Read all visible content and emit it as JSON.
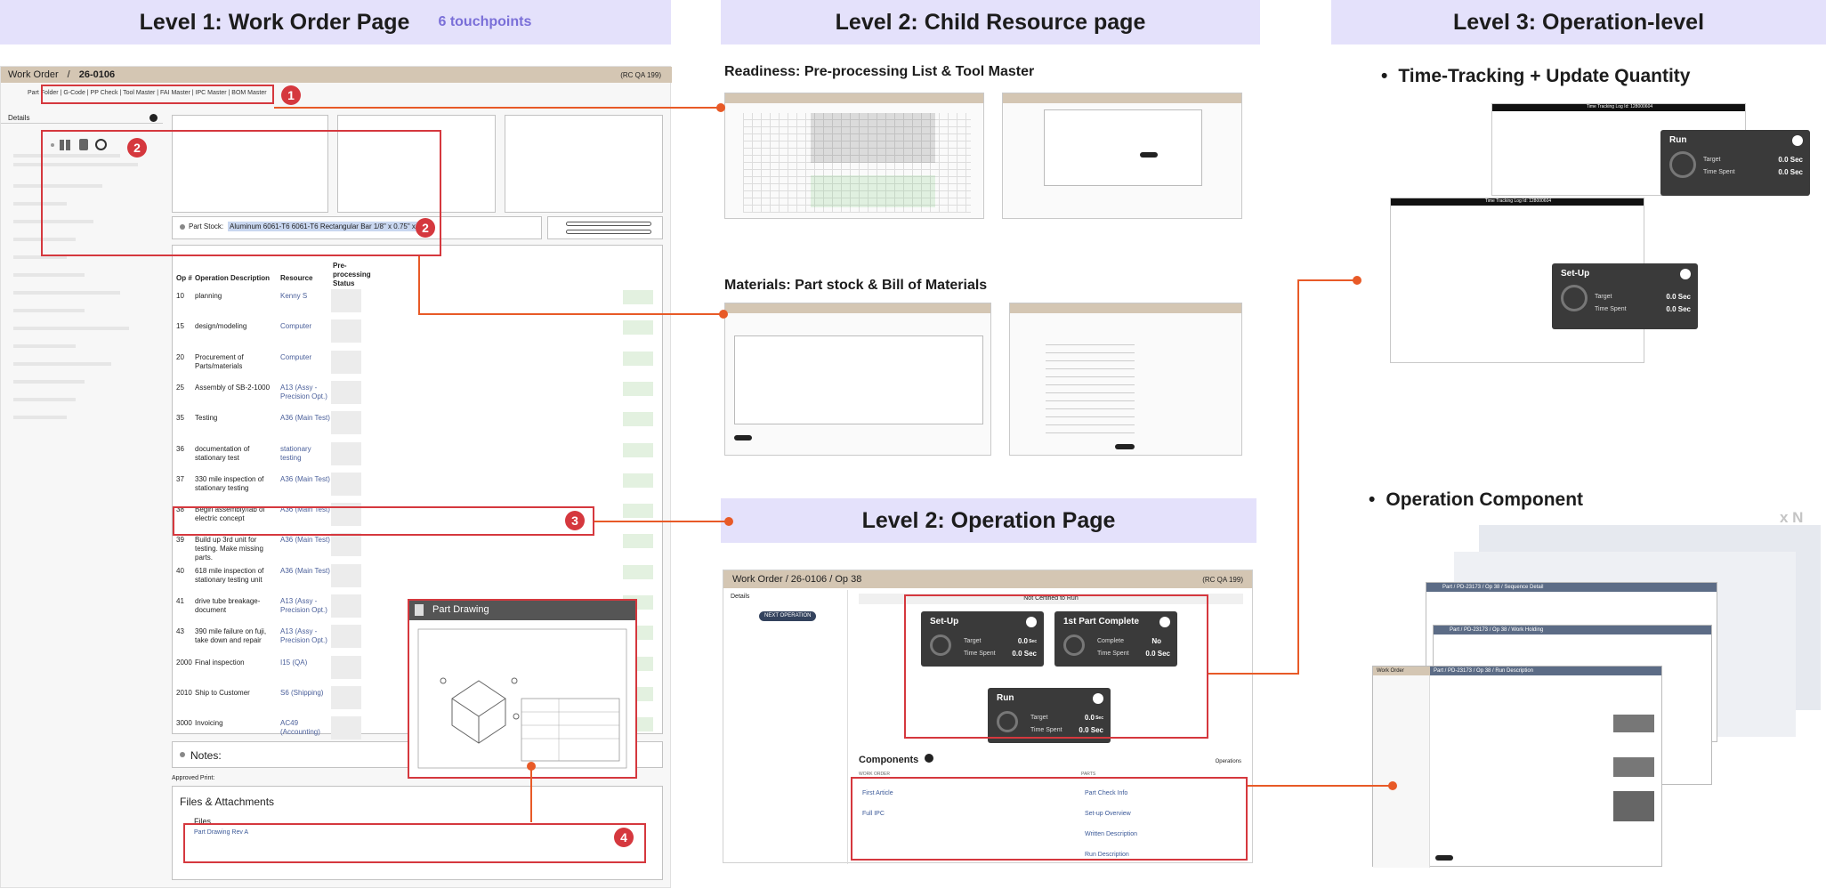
{
  "bands": {
    "level1_title": "Level 1: Work Order Page",
    "level1_touchpoints": "6 touchpoints",
    "level2_child_title": "Level 2: Child Resource page",
    "level3_title": "Level 3: Operation-level",
    "level2_operation_title": "Level 2: Operation Page"
  },
  "sections": {
    "readiness": "Readiness: Pre-processing List & Tool Master",
    "materials": "Materials: Part stock & Bill of Materials",
    "time_tracking": "Time-Tracking + Update Quantity",
    "operation_component": "Operation Component",
    "times_n": "x N"
  },
  "work_order": {
    "breadcrumb_root": "Work Order",
    "breadcrumb_sep": "/",
    "order_id": "26-0106",
    "rc_tag": "(RC QA 199)",
    "master_links": "Part Folder | G-Code | PP Check | Tool Master | FAI Master | IPC Master | BOM Master",
    "details_label": "Details",
    "part_stock_label": "Part Stock:",
    "part_stock_value": "Aluminum 6061-T6 6061-T6 Rectangular Bar 1/8\" x 0.75\" x 48\"",
    "table_headers": [
      "Op #",
      "Operation Description",
      "Resource",
      "Pre-processing Status"
    ],
    "operations": [
      {
        "op": "10",
        "desc": "planning",
        "res": "Kenny S"
      },
      {
        "op": "15",
        "desc": "design/modeling",
        "res": "Computer"
      },
      {
        "op": "20",
        "desc": "Procurement of Parts/materials",
        "res": "Computer"
      },
      {
        "op": "25",
        "desc": "Assembly of SB-2-1000",
        "res": "A13 (Assy - Precision Opt.)"
      },
      {
        "op": "35",
        "desc": "Testing",
        "res": "A36 (Main Test)"
      },
      {
        "op": "36",
        "desc": "documentation of stationary test",
        "res": "stationary testing"
      },
      {
        "op": "37",
        "desc": "330 mile inspection of stationary testing",
        "res": "A36 (Main Test)"
      },
      {
        "op": "38",
        "desc": "Begin assembly/fab of electric concept",
        "res": "A36 (Main Test)"
      },
      {
        "op": "39",
        "desc": "Build up 3rd unit for testing. Make missing parts.",
        "res": "A36 (Main Test)"
      },
      {
        "op": "40",
        "desc": "618 mile inspection of stationary testing unit",
        "res": "A36 (Main Test)"
      },
      {
        "op": "41",
        "desc": "drive tube breakage- document",
        "res": "A13 (Assy - Precision Opt.)"
      },
      {
        "op": "43",
        "desc": "390 mile failure on fuji, take down and repair",
        "res": "A13 (Assy - Precision Opt.)"
      },
      {
        "op": "2000",
        "desc": "Final inspection",
        "res": "I15 (QA)"
      },
      {
        "op": "2010",
        "desc": "Ship to Customer",
        "res": "S6 (Shipping)"
      },
      {
        "op": "3000",
        "desc": "Invoicing",
        "res": "AC49 (Accounting)"
      }
    ],
    "notes_label": "Notes:",
    "approved_print": "Approved Print:",
    "files_attachments": "Files & Attachments",
    "files_label": "Files",
    "file_name": "Part Drawing Rev A",
    "part_drawing_title": "Part Drawing",
    "badges": [
      "1",
      "2",
      "2",
      "3",
      "4"
    ]
  },
  "operation_page": {
    "breadcrumb": "Work Order  /  26-0106  /  Op 38",
    "rc_tag": "(RC QA 199)",
    "details_label": "Details",
    "next_operation": "NEXT OPERATION",
    "not_certified": "Not Certified to Run",
    "components_label": "Components",
    "operations_dropdown": "Operations",
    "work_order_col": "WORK ORDER",
    "parts_col": "PARTS",
    "wo_links": [
      "First Article",
      "Full IPC"
    ],
    "part_links": [
      "Part Check Info",
      "Set-up Overview",
      "Written Description",
      "Run Description"
    ],
    "timers": [
      {
        "title": "Set-Up",
        "label1": "Target",
        "value1": "0.0",
        "unit1": "Sec",
        "label2": "Time Spent",
        "value2": "0.0 Sec"
      },
      {
        "title": "1st Part Complete",
        "label1": "Complete",
        "value1": "No",
        "unit1": "",
        "label2": "Time Spent",
        "value2": "0.0 Sec"
      },
      {
        "title": "Run",
        "label1": "Target",
        "value1": "0.0",
        "unit1": "Sec",
        "label2": "Time Spent",
        "value2": "0.0 Sec"
      }
    ]
  },
  "level3": {
    "time_log_title": "Time Tracking Log Id: 128000604",
    "run_title": "Run",
    "setup_title": "Set-Up",
    "target": "Target",
    "time_spent": "Time Spent",
    "zero_sec": "0.0 Sec",
    "component_breadcrumbs": [
      "Part  /  PD-23173  /  Op 38  /  Sequence Detail",
      "Part  /  PD-23173  /  Op 38  /  Work Holding",
      "Part  /  PD-23173  /  Op 38  /  Run Description"
    ],
    "work_order_tag": "Work Order"
  },
  "colors": {
    "band": "#e4e1fb",
    "accent_red": "#d5383e",
    "connector": "#e85a27",
    "header_tan": "#d4c6b3",
    "timer_dark": "#3a3a3a",
    "touchpoint_purple": "#7a6fd8"
  }
}
